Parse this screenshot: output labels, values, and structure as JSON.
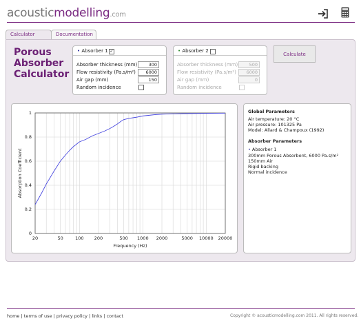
{
  "brand": {
    "part1": "acoustic",
    "part2": "modelling",
    "part3": ".com"
  },
  "header_icons": [
    "login-icon",
    "calculator-icon"
  ],
  "tabs": [
    {
      "label": "Calculator",
      "active": true
    },
    {
      "label": "Documentation",
      "active": false
    }
  ],
  "title_lines": [
    "Porous",
    "Absorber",
    "Calculator"
  ],
  "absorber1": {
    "title": "Absorber 1",
    "checked": true,
    "fields": [
      {
        "label": "Absorber thickness (mm)",
        "value": "300"
      },
      {
        "label": "Flow resistivity (Pa.s/m²)",
        "value": "6000"
      },
      {
        "label": "Air gap (mm)",
        "value": "150"
      }
    ],
    "random_label": "Random incidence",
    "random_checked": false
  },
  "absorber2": {
    "title": "Absorber 2",
    "checked": false,
    "fields": [
      {
        "label": "Absorber thickness (mm)",
        "value": "500"
      },
      {
        "label": "Flow resistivity (Pa.s/m²)",
        "value": "6000"
      },
      {
        "label": "Air gap (mm)",
        "value": "0"
      }
    ],
    "random_label": "Random incidence",
    "random_checked": false
  },
  "calculate_label": "Calculate",
  "chart_data": {
    "type": "line",
    "title": "",
    "xlabel": "Frequency (Hz)",
    "ylabel": "Absorption Coefficient",
    "xscale": "log",
    "xlim": [
      20,
      20000
    ],
    "ylim": [
      0,
      1
    ],
    "xticks": [
      20,
      50,
      100,
      200,
      500,
      1000,
      2000,
      5000,
      10000,
      20000
    ],
    "yticks": [
      0,
      0.2,
      0.4,
      0.6,
      0.8,
      1
    ],
    "ytick_labels": [
      "0",
      "0.2",
      "0.4",
      "0.6",
      "0.8",
      "1"
    ],
    "grid": true,
    "line_color": "#4a4ae0",
    "series": [
      {
        "x": [
          20,
          25,
          30,
          40,
          50,
          60,
          70,
          80,
          100,
          125,
          160,
          200,
          250,
          300,
          350,
          400,
          450,
          500,
          600,
          700,
          800,
          1000,
          1500,
          2000,
          3000,
          5000,
          10000,
          20000
        ],
        "values": [
          0.24,
          0.33,
          0.41,
          0.52,
          0.6,
          0.65,
          0.69,
          0.72,
          0.76,
          0.78,
          0.81,
          0.83,
          0.85,
          0.87,
          0.89,
          0.91,
          0.93,
          0.945,
          0.955,
          0.96,
          0.965,
          0.975,
          0.985,
          0.99,
          0.993,
          0.995,
          0.997,
          0.998
        ]
      }
    ]
  },
  "params": {
    "global_title": "Global Parameters",
    "global_lines": [
      "Air temperature: 20 °C",
      "Air pressure: 101325 Pa",
      "Model: Allard & Champoux (1992)"
    ],
    "absorber_title": "Absorber Parameters",
    "absorber_name": "Absorber 1",
    "absorber_lines": [
      "300mm Porous Absorbent, 6000 Pa.s/m²",
      "150mm Air",
      "Rigid backing",
      "Normal incidence"
    ]
  },
  "footer": {
    "links": [
      "home",
      "terms of use",
      "privacy policy",
      "links",
      "contact"
    ],
    "separator": "|",
    "copyright": "Copyright © acousticmodelling.com 2011. All rights reserved."
  }
}
